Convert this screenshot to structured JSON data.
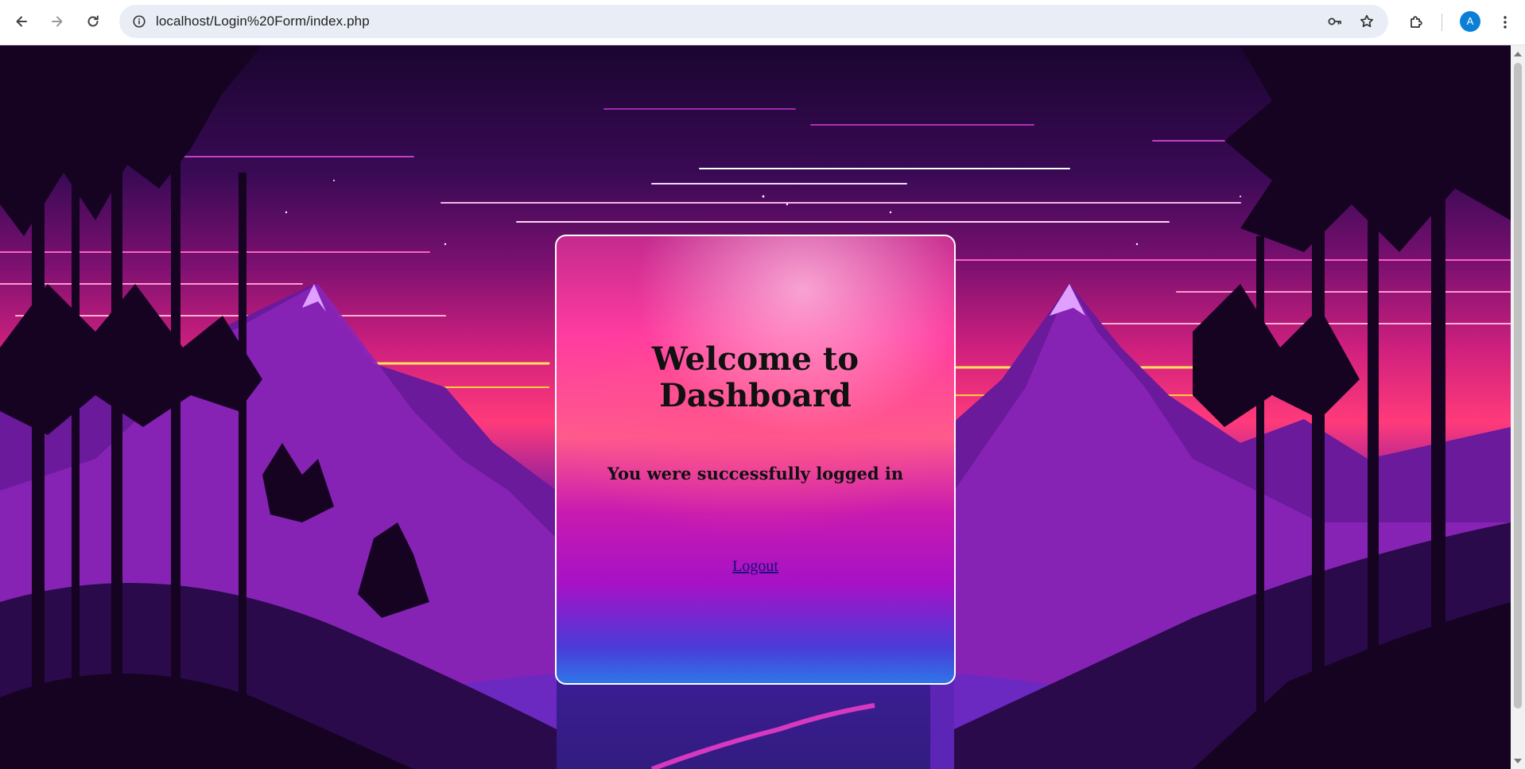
{
  "browser": {
    "url": "localhost/Login%20Form/index.php",
    "profile_initial": "A",
    "accent_color": "#0b7fd6"
  },
  "icons": {
    "back": "arrow-left-icon",
    "forward": "arrow-right-icon",
    "reload": "reload-icon",
    "site_info": "info-icon",
    "password": "key-icon",
    "bookmark": "star-icon",
    "extensions": "puzzle-icon",
    "menu": "kebab-menu-icon"
  },
  "page": {
    "card": {
      "title": "Welcome to Dashboard",
      "message": "You were successfully logged in",
      "logout_label": "Logout"
    }
  }
}
